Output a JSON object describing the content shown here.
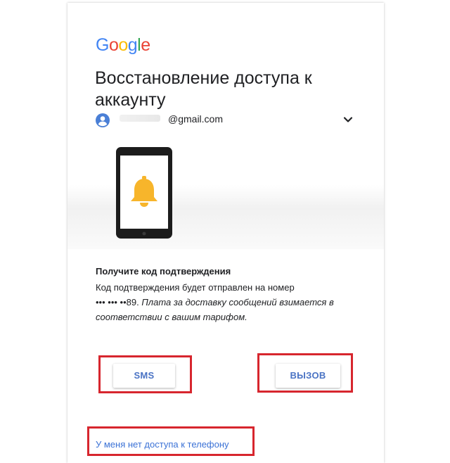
{
  "logo": {
    "letters": [
      "G",
      "o",
      "o",
      "g",
      "l",
      "e"
    ],
    "colors": [
      "#4285f4",
      "#ea4335",
      "#fbbc05",
      "#4285f4",
      "#34a853",
      "#ea4335"
    ]
  },
  "title": "Восстановление доступа к аккаунту",
  "account": {
    "email_suffix": "@gmail.com",
    "avatar_icon": "account-circle-icon",
    "chevron_icon": "chevron-down-icon"
  },
  "illustration": {
    "icon": "phone-bell-icon",
    "bell_color": "#f7b52b"
  },
  "section": {
    "title": "Получите код подтверждения",
    "line1": "Код подтверждения будет отправлен на номер",
    "masked_number": "••• ••• ••89.",
    "note": "Плата за доставку сообщений взимается в соответствии с вашим тарифом."
  },
  "buttons": {
    "sms": "SMS",
    "call": "ВЫЗОВ"
  },
  "link": {
    "no_phone": "У меня нет доступа к телефону"
  },
  "colors": {
    "accent_blue": "#4a73c4",
    "link_blue": "#3b72d6",
    "highlight_red": "#d7262e"
  }
}
